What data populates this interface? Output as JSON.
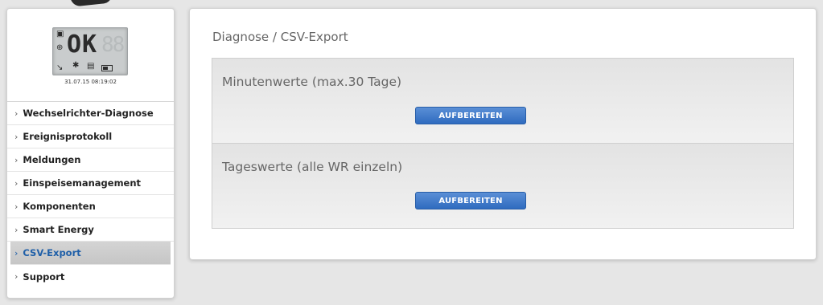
{
  "status": {
    "lcd_text": "OK",
    "timestamp": "31.07.15 08:19:02"
  },
  "sidebar": {
    "items": [
      {
        "label": "Wechselrichter-Diagnose",
        "active": false
      },
      {
        "label": "Ereignisprotokoll",
        "active": false
      },
      {
        "label": "Meldungen",
        "active": false
      },
      {
        "label": "Einspeisemanagement",
        "active": false
      },
      {
        "label": "Komponenten",
        "active": false
      },
      {
        "label": "Smart Energy",
        "active": false
      },
      {
        "label": "CSV-Export",
        "active": true
      },
      {
        "label": "Support",
        "active": false
      }
    ]
  },
  "main": {
    "breadcrumb": "Diagnose / CSV-Export",
    "sections": [
      {
        "title": "Minutenwerte (max.30 Tage)",
        "button_label": "AUFBEREITEN"
      },
      {
        "title": "Tageswerte (alle WR einzeln)",
        "button_label": "AUFBEREITEN"
      }
    ]
  },
  "colors": {
    "accent": "#1f5fa8",
    "button": "#3b78c8"
  }
}
